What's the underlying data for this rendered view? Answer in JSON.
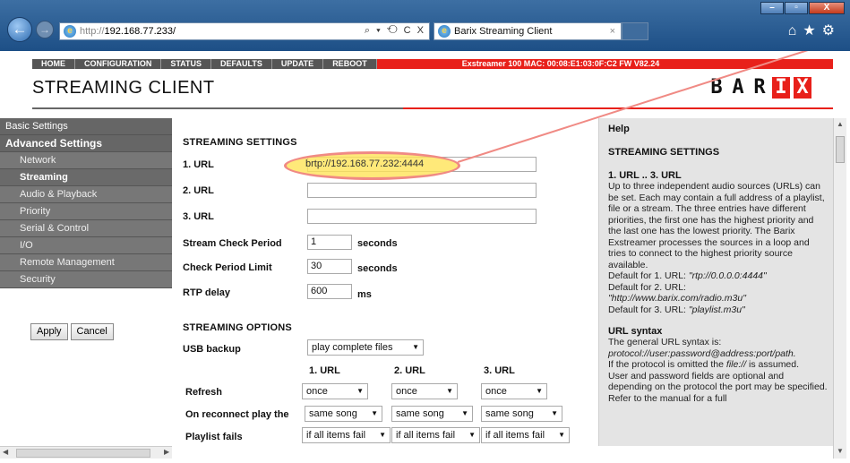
{
  "browser": {
    "address_protocol": "http://",
    "address_host": "192.168.77.233/",
    "address_tools": "⌕ ▾ ⟲ C X",
    "tab_title": "Barix Streaming Client",
    "tab_close": "×",
    "window_buttons": {
      "minimize": "–",
      "maximize": "▫",
      "close": "X"
    },
    "icons": {
      "back": "arrow-left-icon",
      "forward": "arrow-right-icon",
      "home": "home-icon",
      "favorites": "star-icon",
      "tools": "gear-icon"
    }
  },
  "topnav": {
    "items": [
      "HOME",
      "CONFIGURATION",
      "STATUS",
      "DEFAULTS",
      "UPDATE",
      "REBOOT"
    ],
    "device_info": "Exstreamer 100   MAC: 00:08:E1:03:0F:C2  FW V82.24"
  },
  "page": {
    "title": "STREAMING CLIENT",
    "logo_letters": [
      "B",
      "A",
      "R",
      "I",
      "X"
    ]
  },
  "sidebar": {
    "top_items": [
      "Basic Settings",
      "Advanced Settings"
    ],
    "sub_items": [
      "Network",
      "Streaming",
      "Audio & Playback",
      "Priority",
      "Serial & Control",
      "I/O",
      "Remote Management",
      "Security"
    ],
    "active": "Streaming",
    "apply_label": "Apply",
    "cancel_label": "Cancel"
  },
  "streaming_settings": {
    "title": "STREAMING SETTINGS",
    "url1_label": "1. URL",
    "url1_value": "brtp://192.168.77.232:4444",
    "url2_label": "2. URL",
    "url2_value": "",
    "url3_label": "3. URL",
    "url3_value": "",
    "check_period_label": "Stream Check Period",
    "check_period_value": "1",
    "check_period_unit": "seconds",
    "check_limit_label": "Check Period Limit",
    "check_limit_value": "30",
    "check_limit_unit": "seconds",
    "rtp_delay_label": "RTP delay",
    "rtp_delay_value": "600",
    "rtp_delay_unit": "ms"
  },
  "streaming_options": {
    "title": "STREAMING OPTIONS",
    "usb_backup_label": "USB backup",
    "usb_backup_value": "play complete files",
    "col_headers": [
      "1. URL",
      "2. URL",
      "3. URL"
    ],
    "refresh_label": "Refresh",
    "refresh_values": [
      "once",
      "once",
      "once"
    ],
    "reconnect_label": "On reconnect play the",
    "reconnect_values": [
      "same song",
      "same song",
      "same song"
    ],
    "playlist_fails_label": "Playlist fails",
    "playlist_fails_values": [
      "if all items fail",
      "if all items fail",
      "if all items fail"
    ]
  },
  "help": {
    "title": "Help",
    "section_title": "STREAMING SETTINGS",
    "url_heading": "1. URL .. 3. URL",
    "url_text": "Up to three independent audio sources (URLs) can be set. Each may contain a full address of a playlist, file or a stream. The three entries have different priorities, the first one has the highest priority and the last one has the lowest priority. The Barix Exstreamer processes the sources in a loop and tries to connect to the highest priority source available.",
    "default1_label": "Default for 1. URL: ",
    "default1_value": "\"rtp://0.0.0.0:4444\"",
    "default2_label": "Default for 2. URL:",
    "default2_value": "\"http://www.barix.com/radio.m3u\"",
    "default3_label": "Default for 3. URL: ",
    "default3_value": "\"playlist.m3u\"",
    "syntax_heading": "URL syntax",
    "syntax_intro": "The general URL syntax is:",
    "syntax_pattern": "protocol://user:password@address:port/path.",
    "syntax_text1a": "If the protocol is omitted the ",
    "syntax_text1b": "file://",
    "syntax_text1c": " is assumed.",
    "syntax_text2": "User and password fields are optional and depending on the protocol the port may be specified. Refer to the manual for a full"
  },
  "colors": {
    "accent_red": "#e8201a",
    "nav_gray": "#555555",
    "sidebar_gray": "#666666",
    "highlight_yellow": "#ffe458",
    "annotation_pink": "#f08a84"
  }
}
